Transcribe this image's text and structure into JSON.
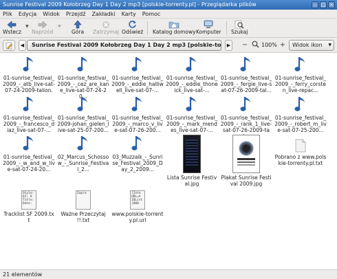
{
  "window": {
    "title": "Sunrise Festival 2009 Kołobrzeg Day 1 Day 2 mp3 [polskie-torrenty.pl] - Przeglądarka plików"
  },
  "menu": [
    "Plik",
    "Edycja",
    "Widok",
    "Przejdź",
    "Zakładki",
    "Karty",
    "Pomoc"
  ],
  "toolbar": {
    "back": "Wstecz",
    "forward": "Naprzód",
    "up": "Góra",
    "stop": "Zatrzymaj",
    "reload": "Odśwież",
    "home": "Katalog domowy",
    "computer": "Komputer",
    "search": "Szukaj"
  },
  "location": {
    "path": "Sunrise Festival 2009 Kołobrzeg Day 1 Day 2 mp3 [polskie-torrenty.pl]",
    "zoom": "100%",
    "view_mode": "Widok ikon"
  },
  "files": [
    {
      "name": "01-sunrise_festival_2009_-_atb_live-sat-07-24-2009-talion.",
      "type": "audio"
    },
    {
      "name": "01-sunrise_festival_2009_-_cez_are_kane_live-sat-07-24-20...",
      "type": "audio"
    },
    {
      "name": "01-sunrise_festival_2009_-_eddie_halliwell_live-sat-07-...",
      "type": "audio"
    },
    {
      "name": "01-sunrise_festival_2009_-_eddie_thoneick_live-sat-...",
      "type": "audio"
    },
    {
      "name": "01-sunrise_festival_2009_-_fergie_live-sat-07-26-2009-tal...",
      "type": "audio"
    },
    {
      "name": "01-sunrise_festival_2009_-_ferry_corsten_live-repac...",
      "type": "audio"
    },
    {
      "name": "01-sunrise_festival_2009_-_francesco_diaz_live-sat-07-...",
      "type": "audio"
    },
    {
      "name": "01-sunrise_festival_2009-johan_gielen_live-sat-25-07-200...",
      "type": "audio"
    },
    {
      "name": "01-sunrise_festival_2009_-_marco_v_live-sat-07-26-200...",
      "type": "audio"
    },
    {
      "name": "01-sunrise_festival_2009_-_mark_mendes_live-sat-07-...",
      "type": "audio"
    },
    {
      "name": "01-sunrise_festival_2009_-_rank_1_live-sat-07-26-2009-tal...",
      "type": "audio"
    },
    {
      "name": "01-sunrise_festival_2009_-_robert_m_live-sat-07-25-200...",
      "type": "audio"
    },
    {
      "name": "01-sunrise_festival_2009_-_w_and_w_live-sat-07-24-20...",
      "type": "audio"
    },
    {
      "name": "02_Marcus_Schossow_-_Sunrise_Festival_2...",
      "type": "audio"
    },
    {
      "name": "03_Muzzaik_-_Sunrise_Festival_2009_Day_2_2009...",
      "type": "audio"
    },
    {
      "name": "Lista Sunrise Festival.jpg",
      "type": "image-dark"
    },
    {
      "name": "Plakat Sunrise Festival 2009.jpg",
      "type": "image-poster"
    },
    {
      "name": "Pobrano z www.polskie-torrenty.pl.txt",
      "type": "text"
    },
    {
      "name": "Tracklist SF 2009.txt",
      "type": "text-preview",
      "preview": "Style: DJ: 9 Title: Date:"
    },
    {
      "name": "Ważne Przeczytaj !!.txt",
      "type": "text-preview",
      "preview": "Zapra"
    },
    {
      "name": "www.polskie-torrenty.pl.url",
      "type": "text-preview",
      "preview": "[Inte URL=h IDList [000"
    }
  ],
  "status": "21 elementów",
  "colors": {
    "note": "#2a5fa8",
    "titlebar": "#3a76bd"
  }
}
